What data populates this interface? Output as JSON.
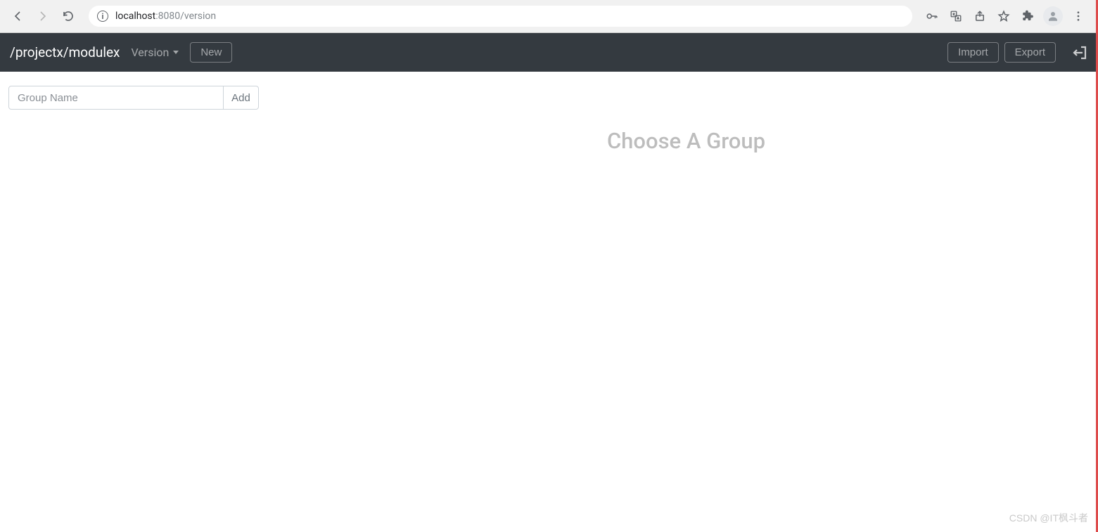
{
  "browser": {
    "url_host": "localhost",
    "url_port_path": ":8080/version"
  },
  "navbar": {
    "brand": "/projectx/modulex",
    "version_label": "Version",
    "new_label": "New",
    "import_label": "Import",
    "export_label": "Export"
  },
  "sidebar": {
    "group_name_placeholder": "Group Name",
    "add_label": "Add"
  },
  "main": {
    "heading": "Choose A Group"
  },
  "watermark": "CSDN @IT枫斗者"
}
